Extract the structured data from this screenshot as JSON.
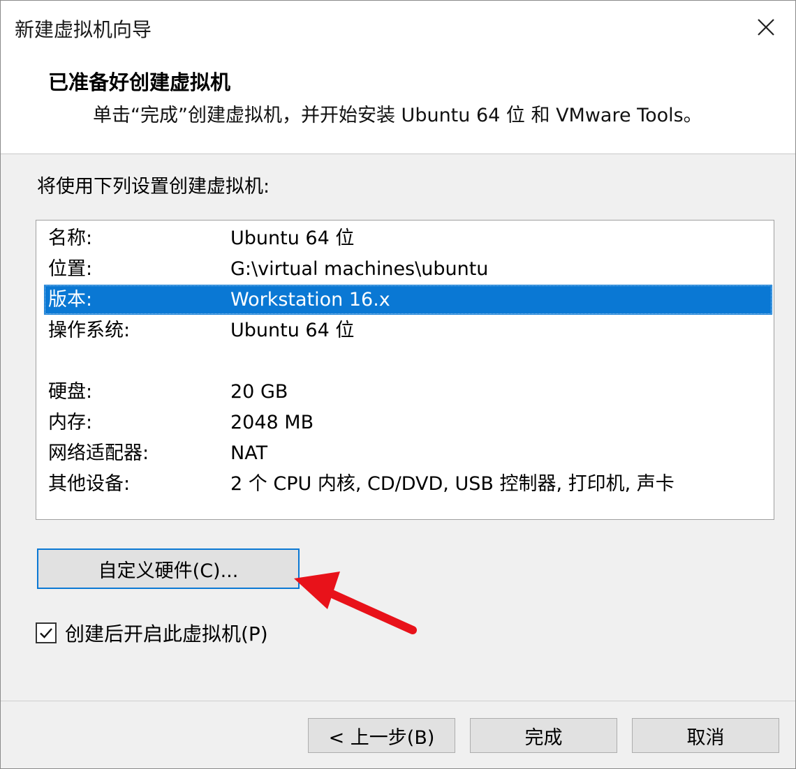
{
  "window": {
    "title": "新建虚拟机向导"
  },
  "header": {
    "title": "已准备好创建虚拟机",
    "subtitle": "单击“完成”创建虚拟机，并开始安装 Ubuntu 64 位 和 VMware Tools。"
  },
  "intro": "将使用下列设置创建虚拟机:",
  "summary": {
    "rows": [
      {
        "label": "名称:",
        "value": "Ubuntu 64 位"
      },
      {
        "label": "位置:",
        "value": "G:\\virtual machines\\ubuntu"
      },
      {
        "label": "版本:",
        "value": "Workstation 16.x"
      },
      {
        "label": "操作系统:",
        "value": "Ubuntu 64 位"
      },
      {
        "label": "硬盘:",
        "value": "20 GB"
      },
      {
        "label": "内存:",
        "value": "2048 MB"
      },
      {
        "label": "网络适配器:",
        "value": "NAT"
      },
      {
        "label": "其他设备:",
        "value": "2 个 CPU 内核, CD/DVD, USB 控制器, 打印机, 声卡"
      }
    ],
    "selected_label": "版本:"
  },
  "customize_button": "自定义硬件(C)...",
  "power_on": {
    "label": "创建后开启此虚拟机(P)",
    "checked": true
  },
  "footer": {
    "back": "< 上一步(B)",
    "finish": "完成",
    "cancel": "取消"
  },
  "colors": {
    "selection": "#0a78d4",
    "annotation_arrow": "#e8121a"
  },
  "icons": {
    "close": "close-icon",
    "check": "checkmark-icon",
    "annotation": "red-arrow-annotation"
  }
}
